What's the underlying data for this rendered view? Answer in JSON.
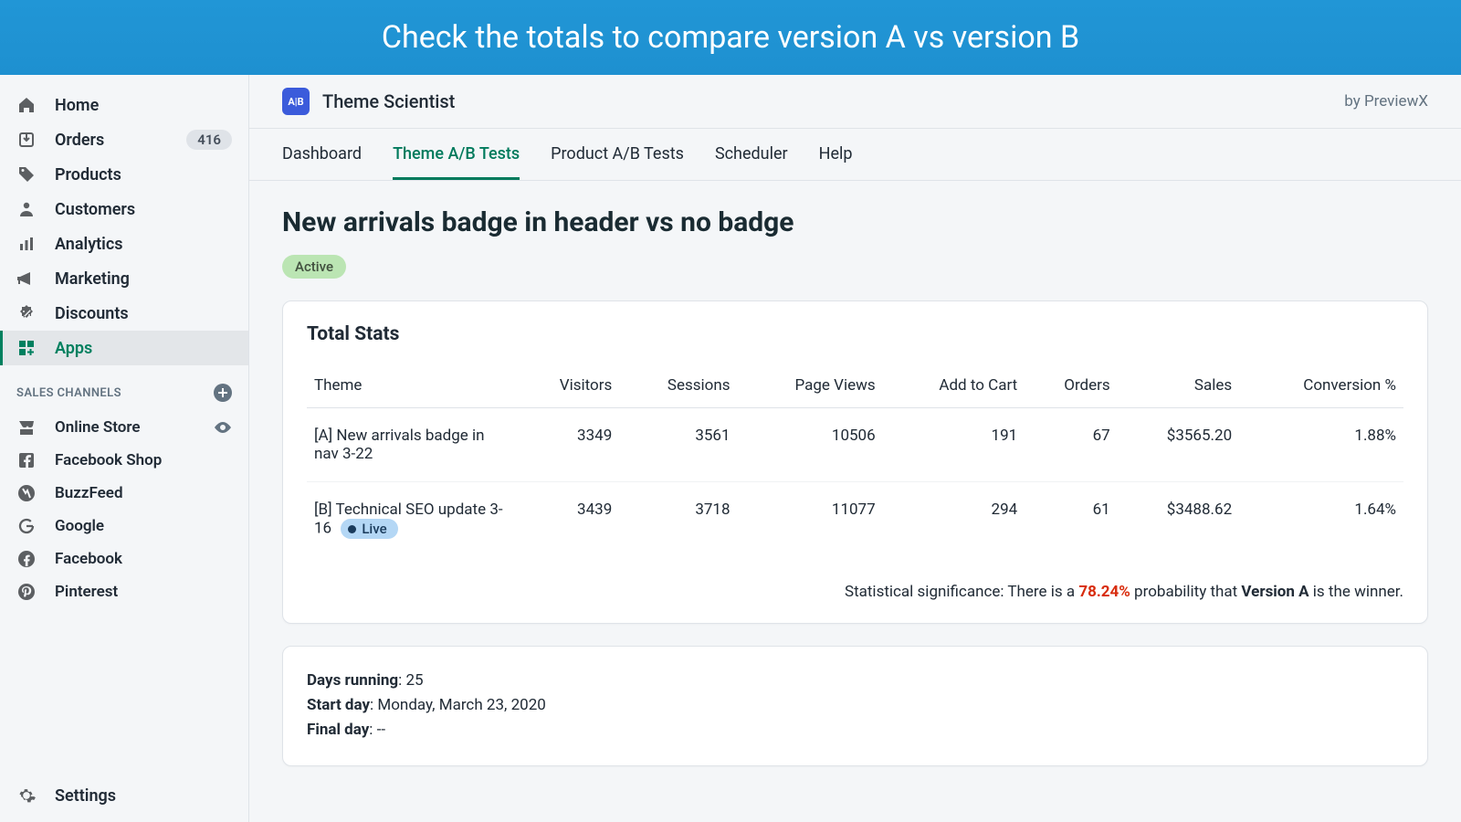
{
  "banner": "Check the totals to compare version A vs version B",
  "sidebar": {
    "items": [
      {
        "label": "Home"
      },
      {
        "label": "Orders",
        "badge": "416"
      },
      {
        "label": "Products"
      },
      {
        "label": "Customers"
      },
      {
        "label": "Analytics"
      },
      {
        "label": "Marketing"
      },
      {
        "label": "Discounts"
      },
      {
        "label": "Apps"
      }
    ],
    "section": "SALES CHANNELS",
    "channels": [
      {
        "label": "Online Store"
      },
      {
        "label": "Facebook Shop"
      },
      {
        "label": "BuzzFeed"
      },
      {
        "label": "Google"
      },
      {
        "label": "Facebook"
      },
      {
        "label": "Pinterest"
      }
    ],
    "settings": "Settings"
  },
  "app": {
    "logo_text": "A|B",
    "title": "Theme Scientist",
    "by": "by PreviewX"
  },
  "tabs": [
    "Dashboard",
    "Theme A/B Tests",
    "Product A/B Tests",
    "Scheduler",
    "Help"
  ],
  "active_tab": 1,
  "page": {
    "title": "New arrivals badge in header vs no badge",
    "status": "Active"
  },
  "stats": {
    "heading": "Total Stats",
    "columns": [
      "Theme",
      "Visitors",
      "Sessions",
      "Page Views",
      "Add to Cart",
      "Orders",
      "Sales",
      "Conversion %"
    ],
    "rows": [
      {
        "theme": "[A] New arrivals badge in nav 3-22",
        "live": false,
        "cells": [
          "3349",
          "3561",
          "10506",
          "191",
          "67",
          "$3565.20",
          "1.88%"
        ]
      },
      {
        "theme": "[B] Technical SEO update 3-16",
        "live": true,
        "live_label": "Live",
        "cells": [
          "3439",
          "3718",
          "11077",
          "294",
          "61",
          "$3488.62",
          "1.64%"
        ]
      }
    ],
    "sig_prefix": "Statistical significance: There is a ",
    "sig_pct": "78.24%",
    "sig_mid": " probability that ",
    "sig_version": "Version A",
    "sig_suffix": " is the winner."
  },
  "meta": {
    "days_label": "Days running",
    "days_value": "25",
    "start_label": "Start day",
    "start_value": "Monday, March 23, 2020",
    "final_label": "Final day",
    "final_value": "--"
  }
}
